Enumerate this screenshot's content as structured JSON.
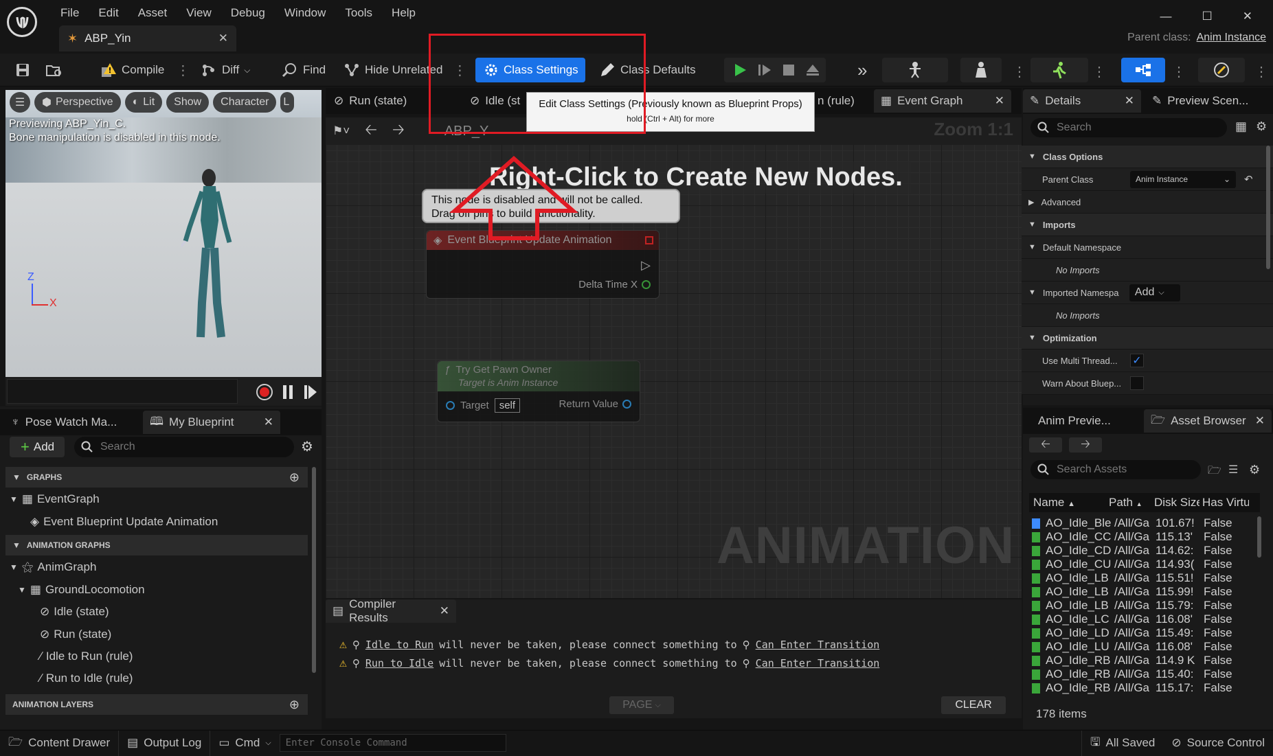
{
  "menu": [
    "File",
    "Edit",
    "Asset",
    "View",
    "Debug",
    "Window",
    "Tools",
    "Help"
  ],
  "doc_tab": {
    "label": "ABP_Yin"
  },
  "parent_class": {
    "label": "Parent class:",
    "value": "Anim Instance"
  },
  "toolbar": {
    "compile": "Compile",
    "diff": "Diff",
    "find": "Find",
    "hide_unrelated": "Hide Unrelated",
    "class_settings": "Class Settings",
    "class_defaults": "Class Defaults"
  },
  "tooltip": {
    "title": "Edit Class Settings (Previously known as Blueprint Props)",
    "hint": "hold (Ctrl + Alt) for more"
  },
  "viewport": {
    "buttons": [
      "Perspective",
      "Lit",
      "Show",
      "Character",
      "L"
    ],
    "line1": "Previewing ABP_Yin_C.",
    "line2": "Bone manipulation is disabled in this mode.",
    "axis_z": "Z",
    "axis_x": "X"
  },
  "graph_tabs": [
    "Run (state)",
    "Idle (st",
    "n (rule)",
    "Event Graph"
  ],
  "graph": {
    "breadcrumb": "ABP_Y",
    "zoom": "Zoom 1:1",
    "hint": "Right-Click to Create New Nodes.",
    "watermark": "ANIMATION",
    "disabled_note_1": "This node is disabled and will not be called.",
    "disabled_note_2": "Drag off pins to build functionality.",
    "event_node": {
      "title": "Event Blueprint Update Animation",
      "pin": "Delta Time X"
    },
    "func_node": {
      "title": "Try Get Pawn Owner",
      "subtitle": "Target is Anim Instance",
      "target": "Target",
      "self": "self",
      "return": "Return Value"
    }
  },
  "left_tabs": {
    "pose_watch": "Pose Watch Ma...",
    "my_blueprint": "My Blueprint"
  },
  "my_blueprint": {
    "add": "Add",
    "search_placeholder": "Search",
    "sections": {
      "graphs": "GRAPHS",
      "anim_graphs": "ANIMATION GRAPHS",
      "anim_layers": "ANIMATION LAYERS"
    },
    "items": {
      "event_graph": "EventGraph",
      "event_update": "Event Blueprint Update Animation",
      "anim_graph": "AnimGraph",
      "ground": "GroundLocomotion",
      "idle": "Idle (state)",
      "run": "Run (state)",
      "idle_to_run": "Idle to Run (rule)",
      "run_to_idle": "Run to Idle (rule)"
    }
  },
  "compiler": {
    "tab": "Compiler Results",
    "page": "PAGE",
    "clear": "CLEAR",
    "messages": [
      {
        "link": "Idle to Run",
        "text": "will never be taken, please connect something to",
        "target": "Can Enter Transition"
      },
      {
        "link": "Run to Idle",
        "text": "will never be taken, please connect something to",
        "target": "Can Enter Transition"
      }
    ]
  },
  "details": {
    "tab": "Details",
    "preview_tab": "Preview Scen...",
    "search_placeholder": "Search",
    "class_options": "Class Options",
    "parent_class_label": "Parent Class",
    "parent_class_value": "Anim Instance",
    "advanced": "Advanced",
    "imports": "Imports",
    "default_namespace": "Default Namespace",
    "no_imports": "No Imports",
    "imported_namespaces": "Imported Namespa",
    "add": "Add",
    "optimization": "Optimization",
    "use_multi": "Use Multi Thread...",
    "warn_about": "Warn About Bluep...",
    "use_multi_checked": true,
    "warn_checked": false
  },
  "asset_browser": {
    "anim_preview_tab": "Anim Previe...",
    "tab": "Asset Browser",
    "search_placeholder": "Search Assets",
    "columns": [
      "Name",
      "Path",
      "Disk Size",
      "Has Virtu"
    ],
    "count": "178 items",
    "rows": [
      [
        "AO_Idle_Ble",
        "/All/Ga",
        "101.67!",
        "False"
      ],
      [
        "AO_Idle_CC",
        "/All/Ga",
        "115.13'",
        "False"
      ],
      [
        "AO_Idle_CD",
        "/All/Ga",
        "114.62:",
        "False"
      ],
      [
        "AO_Idle_CU",
        "/All/Ga",
        "114.93(",
        "False"
      ],
      [
        "AO_Idle_LB",
        "/All/Ga",
        "115.51!",
        "False"
      ],
      [
        "AO_Idle_LB",
        "/All/Ga",
        "115.99!",
        "False"
      ],
      [
        "AO_Idle_LB",
        "/All/Ga",
        "115.79:",
        "False"
      ],
      [
        "AO_Idle_LC",
        "/All/Ga",
        "116.08'",
        "False"
      ],
      [
        "AO_Idle_LD",
        "/All/Ga",
        "115.49:",
        "False"
      ],
      [
        "AO_Idle_LU",
        "/All/Ga",
        "116.08'",
        "False"
      ],
      [
        "AO_Idle_RB",
        "/All/Ga",
        "114.9 K",
        "False"
      ],
      [
        "AO_Idle_RB",
        "/All/Ga",
        "115.40:",
        "False"
      ],
      [
        "AO_Idle_RB",
        "/All/Ga",
        "115.17:",
        "False"
      ]
    ]
  },
  "statusbar": {
    "content_drawer": "Content Drawer",
    "output_log": "Output Log",
    "cmd": "Cmd",
    "console_placeholder": "Enter Console Command",
    "all_saved": "All Saved",
    "source_control": "Source Control"
  },
  "colors": {
    "accent": "#1a72e8",
    "highlight": "#e01b24",
    "node_red": "#6e1f1f",
    "node_green": "#2e4a2e"
  }
}
